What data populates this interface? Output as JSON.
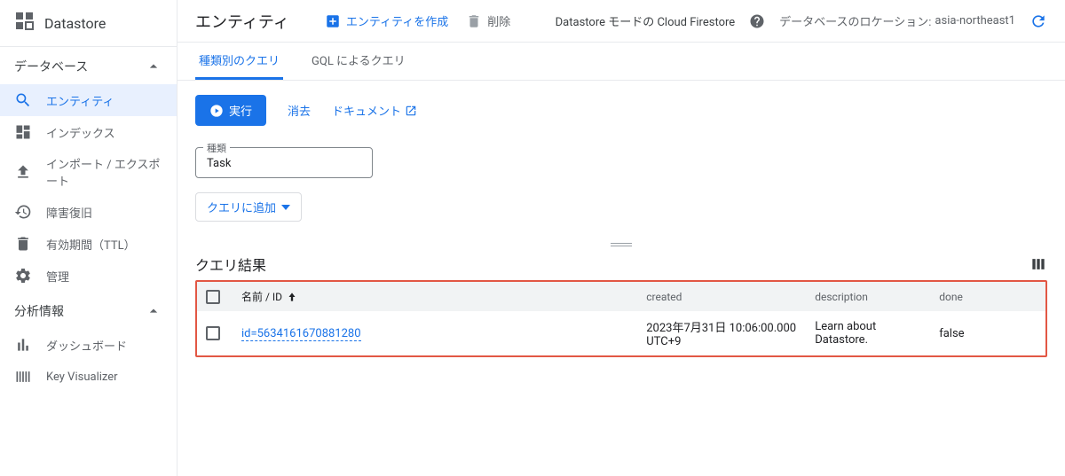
{
  "product_name": "Datastore",
  "sidebar": {
    "section1": {
      "title": "データベース",
      "items": [
        {
          "label": "エンティティ"
        },
        {
          "label": "インデックス"
        },
        {
          "label": "インポート / エクスポート"
        },
        {
          "label": "障害復旧"
        },
        {
          "label": "有効期間（TTL）"
        },
        {
          "label": "管理"
        }
      ]
    },
    "section2": {
      "title": "分析情報",
      "items": [
        {
          "label": "ダッシュボード"
        },
        {
          "label": "Key Visualizer"
        }
      ]
    }
  },
  "header": {
    "title": "エンティティ",
    "create_label": "エンティティを作成",
    "delete_label": "削除",
    "mode_text": "Datastore モードの Cloud Firestore",
    "location_label": "データベースのロケーション:",
    "location_value": "asia-northeast1"
  },
  "tabs": {
    "kind_query": "種類別のクエリ",
    "gql_query": "GQL によるクエリ"
  },
  "query": {
    "run_label": "実行",
    "clear_label": "消去",
    "docs_label": "ドキュメント",
    "kind_field_label": "種類",
    "kind_value": "Task",
    "add_to_query_label": "クエリに追加"
  },
  "results": {
    "title": "クエリ結果",
    "columns": {
      "name": "名前 / ID",
      "created": "created",
      "description": "description",
      "done": "done"
    },
    "rows": [
      {
        "id": "id=5634161670881280",
        "created": "2023年7月31日 10:06:00.000 UTC+9",
        "description": "Learn about Datastore.",
        "done": "false"
      }
    ]
  }
}
